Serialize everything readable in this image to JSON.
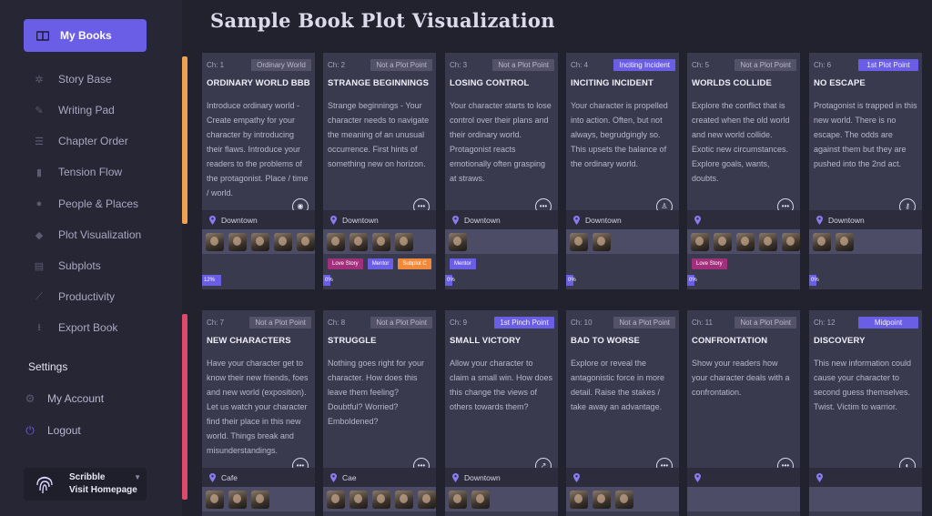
{
  "app": {
    "title": "Sample Book Plot Visualization"
  },
  "sidebar": {
    "mybooks": "My Books",
    "items": [
      {
        "label": "Story Base",
        "icon": "story-base-icon"
      },
      {
        "label": "Writing Pad",
        "icon": "writing-pad-icon"
      },
      {
        "label": "Chapter Order",
        "icon": "chapter-order-icon"
      },
      {
        "label": "Tension Flow",
        "icon": "tension-flow-icon"
      },
      {
        "label": "People & Places",
        "icon": "people-places-icon"
      },
      {
        "label": "Plot Visualization",
        "icon": "plot-visualization-icon"
      },
      {
        "label": "Subplots",
        "icon": "subplots-icon"
      },
      {
        "label": "Productivity",
        "icon": "productivity-icon"
      },
      {
        "label": "Export Book",
        "icon": "export-book-icon"
      }
    ],
    "settings_title": "Settings",
    "my_account": "My Account",
    "logout": "Logout",
    "brand_name": "Scribble",
    "brand_link": "Visit Homepage"
  },
  "colors": {
    "accent": "#6b5ee6",
    "row1_bar": "#f0a050",
    "row2_bar": "#e04a6a",
    "tag_love": "#a0307c",
    "tag_mentor": "#6b5ee6",
    "tag_subplot": "#f08a3a"
  },
  "cards": [
    {
      "ch": "Ch: 1",
      "badge": "Ordinary World",
      "hl": false,
      "title": "ORDINARY WORLD BBB",
      "desc": "Introduce ordinary world - Create empathy for your character by introducing their flaws. Introduce your readers to the problems of the protagonist. Place / time / world.",
      "icon": "globe-icon",
      "loc": "Downtown",
      "people": 5,
      "tags": [],
      "progress": "12%",
      "progress_pct": 12
    },
    {
      "ch": "Ch: 2",
      "badge": "Not a Plot Point",
      "hl": false,
      "title": "STRANGE BEGINNINGS",
      "desc": "Strange beginnings - Your character needs to navigate the meaning of an unusual occurrence. First hints of something new on horizon.",
      "icon": "more-icon",
      "loc": "Downtown",
      "people": 4,
      "tags": [
        {
          "label": "Love Story",
          "color": "#a0307c"
        },
        {
          "label": "Mentor",
          "color": "#6b5ee6"
        },
        {
          "label": "Subplot C",
          "color": "#f08a3a"
        }
      ],
      "progress": "0%",
      "progress_pct": 0
    },
    {
      "ch": "Ch: 3",
      "badge": "Not a Plot Point",
      "hl": false,
      "title": "LOSING CONTROL",
      "desc": "Your character starts to lose control over their plans and their ordinary world. Protagonist reacts emotionally often grasping at straws.",
      "icon": "more-icon",
      "loc": "Downtown",
      "people": 1,
      "tags": [
        {
          "label": "Mentor",
          "color": "#6b5ee6"
        }
      ],
      "progress": "0%",
      "progress_pct": 0
    },
    {
      "ch": "Ch: 4",
      "badge": "Inciting Incident",
      "hl": true,
      "title": "INCITING INCIDENT",
      "desc": "Your character is propelled into action. Often, but not always, begrudgingly so. This upsets the balance of the ordinary world.",
      "icon": "person-icon",
      "loc": "Downtown",
      "people": 2,
      "tags": [],
      "progress": "0%",
      "progress_pct": 0
    },
    {
      "ch": "Ch: 5",
      "badge": "Not a Plot Point",
      "hl": false,
      "title": "WORLDS COLLIDE",
      "desc": "Explore the conflict that is created when the old world and new world collide. Exotic new circumstances. Explore goals, wants, doubts.",
      "icon": "more-icon",
      "loc": "",
      "people": 5,
      "tags": [
        {
          "label": "Love Story",
          "color": "#a0307c"
        }
      ],
      "progress": "0%",
      "progress_pct": 0
    },
    {
      "ch": "Ch: 6",
      "badge": "1st Plot Point",
      "hl": true,
      "title": "NO ESCAPE",
      "desc": "Protagonist is trapped in this new world. There is no escape. The odds are against them but they are pushed into the 2nd act.",
      "icon": "key-icon",
      "loc": "Downtown",
      "people": 2,
      "tags": [],
      "progress": "0%",
      "progress_pct": 0
    },
    {
      "ch": "Ch: 7",
      "badge": "Not a Plot Point",
      "hl": false,
      "title": "NEW CHARACTERS",
      "desc": "Have your character get to know their new friends, foes and new world (exposition). Let us watch your character find their place in this new world. Things break and misunderstandings.",
      "icon": "more-icon",
      "loc": "Cafe",
      "people": 3,
      "tags": [],
      "progress": "",
      "progress_pct": 0
    },
    {
      "ch": "Ch: 8",
      "badge": "Not a Plot Point",
      "hl": false,
      "title": "STRUGGLE",
      "desc": "Nothing goes right for your character. How does this leave them feeling? Doubtful? Worried? Emboldened?",
      "icon": "more-icon",
      "loc": "Cae",
      "people": 5,
      "tags": [],
      "progress": "",
      "progress_pct": 0
    },
    {
      "ch": "Ch: 9",
      "badge": "1st Pinch Point",
      "hl": true,
      "title": "SMALL VICTORY",
      "desc": "Allow your character to claim a small win. How does this change the views of others towards them?",
      "icon": "pin-icon",
      "loc": "Downtown",
      "people": 2,
      "tags": [],
      "progress": "",
      "progress_pct": 0
    },
    {
      "ch": "Ch: 10",
      "badge": "Not a Plot Point",
      "hl": false,
      "title": "BAD TO WORSE",
      "desc": "Explore or reveal the antagonistic force in more detail. Raise the stakes / take away an advantage.",
      "icon": "more-icon",
      "loc": "",
      "people": 3,
      "tags": [],
      "progress": "",
      "progress_pct": 0
    },
    {
      "ch": "Ch: 11",
      "badge": "Not a Plot Point",
      "hl": false,
      "title": "CONFRONTATION",
      "desc": "Show your readers how your character deals with a confrontation.",
      "icon": "more-icon",
      "loc": "",
      "people": 0,
      "tags": [],
      "progress": "",
      "progress_pct": 0
    },
    {
      "ch": "Ch: 12",
      "badge": "Midpoint",
      "hl": true,
      "title": "DISCOVERY",
      "desc": "This new information could cause your character to second guess themselves. Twist. Victim to warrior.",
      "icon": "half-circle-icon",
      "loc": "",
      "people": 0,
      "tags": [],
      "progress": "",
      "progress_pct": 0
    }
  ]
}
